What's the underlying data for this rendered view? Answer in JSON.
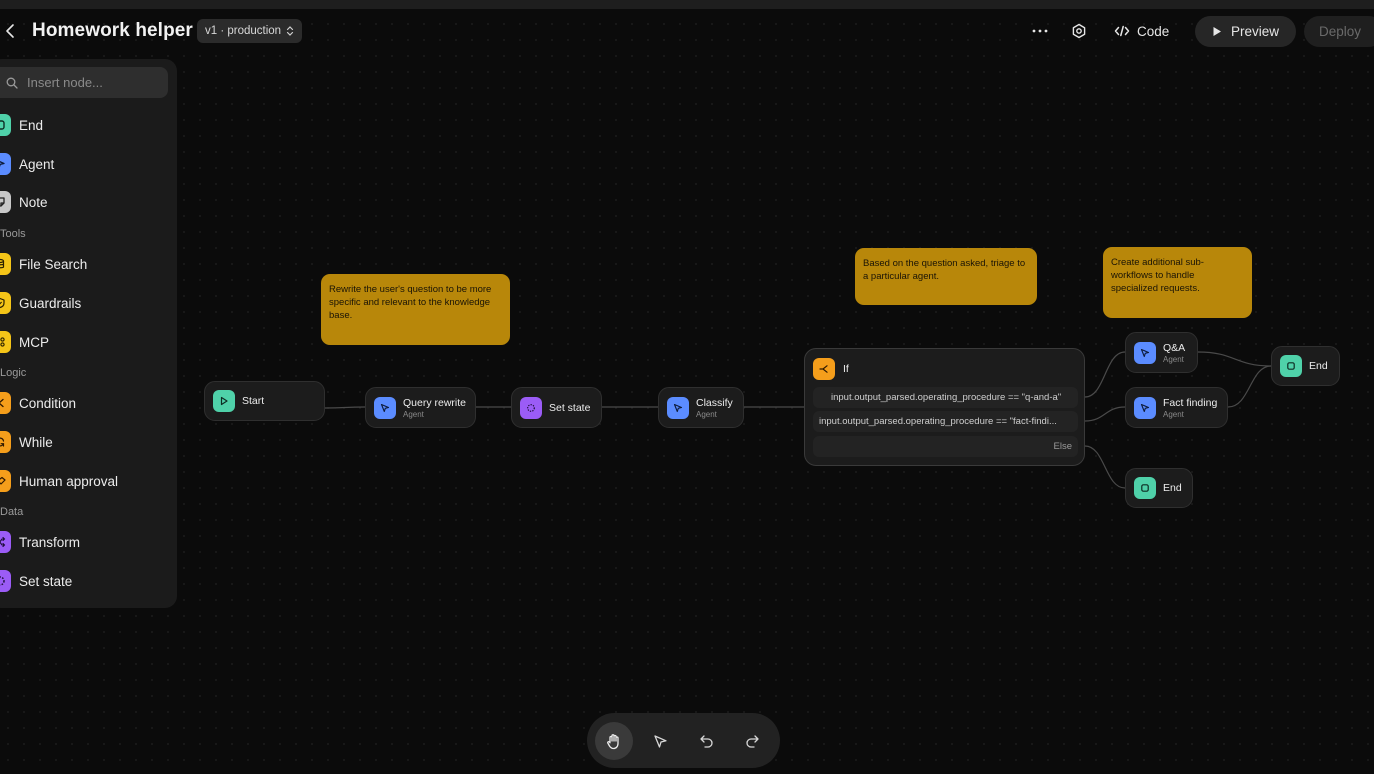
{
  "header": {
    "title": "Homework helper",
    "version": "v1 · production",
    "code_label": "Code",
    "preview_label": "Preview",
    "deploy_label": "Deploy"
  },
  "sidebar": {
    "search_placeholder": "Insert node...",
    "core": [
      {
        "label": "End",
        "icon": "square-icon",
        "color": "#4fd1a9"
      },
      {
        "label": "Agent",
        "icon": "cursor-icon",
        "color": "#5b8cff"
      },
      {
        "label": "Note",
        "icon": "note-icon",
        "color": "#c8c8c8"
      }
    ],
    "tools_heading": "Tools",
    "tools": [
      {
        "label": "File Search",
        "icon": "database-icon",
        "color": "#f5c518"
      },
      {
        "label": "Guardrails",
        "icon": "shield-icon",
        "color": "#f5c518"
      },
      {
        "label": "MCP",
        "icon": "mcp-icon",
        "color": "#f5c518"
      }
    ],
    "logic_heading": "Logic",
    "logic": [
      {
        "label": "Condition",
        "icon": "branch-icon",
        "color": "#f59e1b"
      },
      {
        "label": "While",
        "icon": "loop-icon",
        "color": "#f59e1b"
      },
      {
        "label": "Human approval",
        "icon": "handshake-icon",
        "color": "#f59e1b"
      }
    ],
    "data_heading": "Data",
    "data": [
      {
        "label": "Transform",
        "icon": "shuffle-icon",
        "color": "#9b5cf6"
      },
      {
        "label": "Set state",
        "icon": "dotted-circle-icon",
        "color": "#9b5cf6"
      }
    ]
  },
  "canvas": {
    "notes": {
      "rewrite": "Rewrite the user's question to be more specific and relevant to the knowledge base.",
      "triage": "Based on the question asked, triage to a particular agent.",
      "subworkflows": "Create additional sub-workflows to handle specialized requests."
    },
    "nodes": {
      "start": {
        "label": "Start"
      },
      "query_rewrite": {
        "label": "Query rewrite",
        "sub": "Agent"
      },
      "set_state": {
        "label": "Set state"
      },
      "classify": {
        "label": "Classify",
        "sub": "Agent"
      },
      "qa": {
        "label": "Q&A",
        "sub": "Agent"
      },
      "fact_finding": {
        "label": "Fact finding",
        "sub": "Agent"
      },
      "end_top": {
        "label": "End"
      },
      "end_bottom": {
        "label": "End"
      }
    },
    "if_node": {
      "label": "If",
      "conditions": [
        "input.output_parsed.operating_procedure == \"q-and-a\"",
        "input.output_parsed.operating_procedure == \"fact-findi..."
      ],
      "else_label": "Else"
    }
  },
  "toolbar": {
    "tools": [
      "hand-icon",
      "pointer-icon",
      "undo-icon",
      "redo-icon"
    ],
    "active": "hand-icon"
  }
}
